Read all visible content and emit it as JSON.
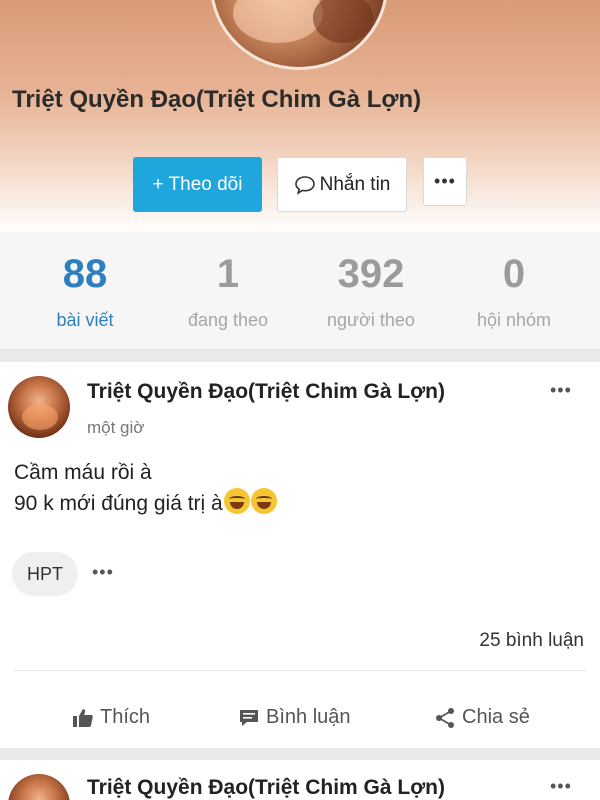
{
  "profile": {
    "name": "Triệt Quyền Đạo(Triệt Chim Gà Lợn)",
    "follow_label": "+ Theo dõi",
    "message_label": "Nhắn tin",
    "more_label": "•••"
  },
  "stats": [
    {
      "value": "88",
      "label": "bài viết",
      "active": true
    },
    {
      "value": "1",
      "label": "đang theo",
      "active": false
    },
    {
      "value": "392",
      "label": "người theo",
      "active": false
    },
    {
      "value": "0",
      "label": "hội nhóm",
      "active": false
    }
  ],
  "posts": [
    {
      "author": "Triệt Quyền Đạo(Triệt Chim Gà Lợn)",
      "time": "một giờ",
      "menu": "•••",
      "lines": [
        "Cầm máu rồi à",
        "90 k mới đúng giá trị à"
      ],
      "emojis": [
        "grinning-sweat-emoji",
        "grinning-sweat-emoji"
      ],
      "tag": "HPT",
      "tag_more": "•••",
      "comments": "25 bình luận",
      "actions": {
        "like": "Thích",
        "comment": "Bình luận",
        "share": "Chia sẻ"
      }
    },
    {
      "author": "Triệt Quyền Đạo(Triệt Chim Gà Lợn)",
      "menu": "•••"
    }
  ],
  "colors": {
    "accent": "#1fa7dd",
    "active_stat": "#2d7fbd",
    "inactive_stat": "#9b9b9b"
  }
}
